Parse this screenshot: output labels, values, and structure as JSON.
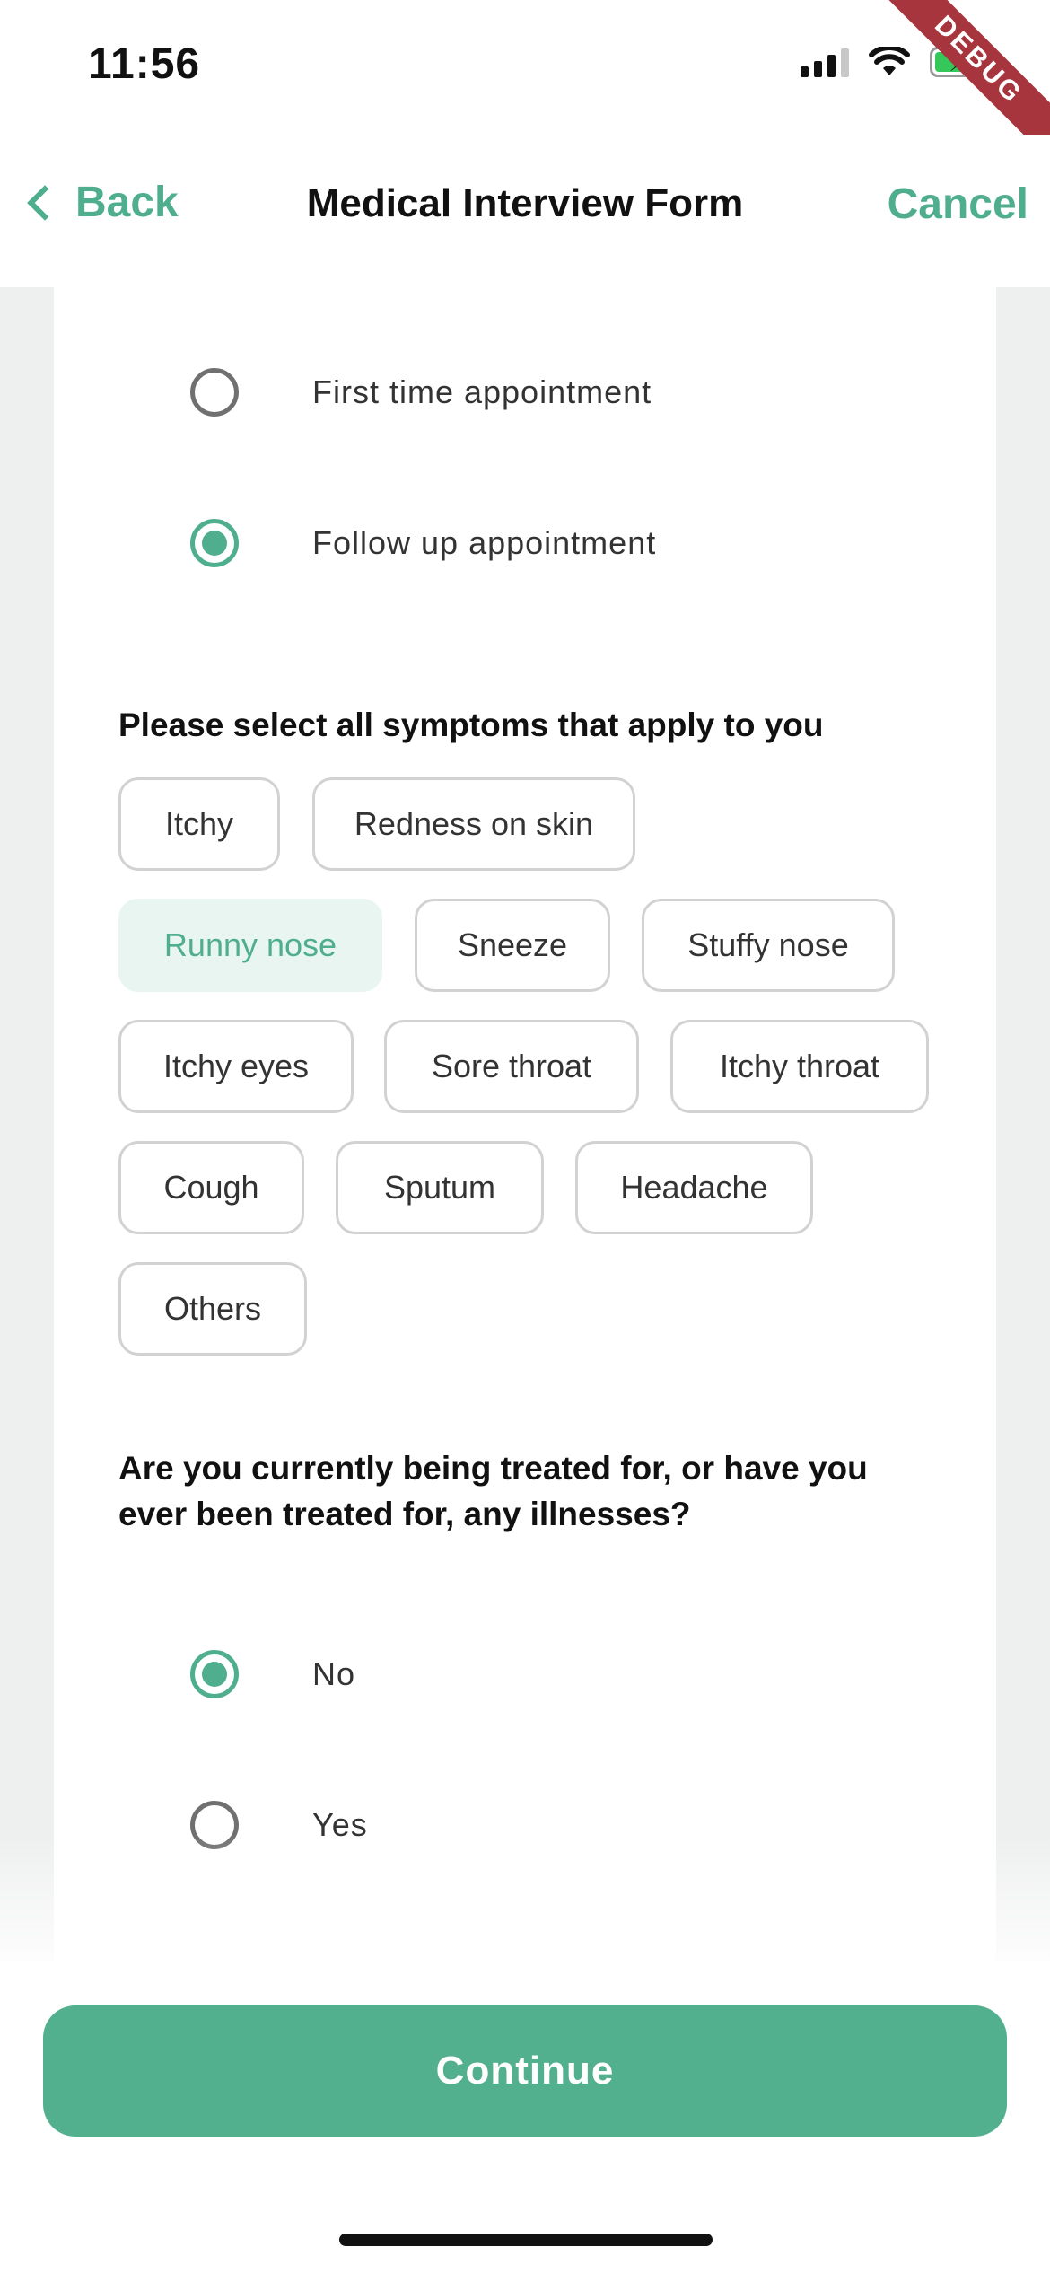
{
  "status_bar": {
    "time": "11:56",
    "debug_label": "DEBUG",
    "icons": [
      "signal-icon",
      "wifi-icon",
      "battery-charging-icon"
    ]
  },
  "nav": {
    "back_label": "Back",
    "title": "Medical Interview Form",
    "cancel_label": "Cancel"
  },
  "appointment": {
    "options": [
      {
        "label": "First time appointment",
        "checked": false
      },
      {
        "label": "Follow up appointment",
        "checked": true
      }
    ]
  },
  "symptoms": {
    "question": "Please select all symptoms that apply to you",
    "chips": [
      {
        "label": "Itchy",
        "selected": false
      },
      {
        "label": "Redness on skin",
        "selected": false
      },
      {
        "label": "Runny nose",
        "selected": true
      },
      {
        "label": "Sneeze",
        "selected": false
      },
      {
        "label": "Stuffy nose",
        "selected": false
      },
      {
        "label": "Itchy eyes",
        "selected": false
      },
      {
        "label": "Sore throat",
        "selected": false
      },
      {
        "label": "Itchy throat",
        "selected": false
      },
      {
        "label": "Cough",
        "selected": false
      },
      {
        "label": "Sputum",
        "selected": false
      },
      {
        "label": "Headache",
        "selected": false
      },
      {
        "label": "Others",
        "selected": false
      }
    ]
  },
  "illness": {
    "question": "Are you currently being treated for, or have you ever been treated for, any illnesses?",
    "options": [
      {
        "label": "No",
        "checked": true
      },
      {
        "label": "Yes",
        "checked": false
      }
    ]
  },
  "footer": {
    "continue_label": "Continue"
  },
  "colors": {
    "accent": "#4fae8e",
    "button": "#52b08f",
    "chip_selected_bg": "#e8f5f1",
    "page_bg": "#eef0ef"
  }
}
